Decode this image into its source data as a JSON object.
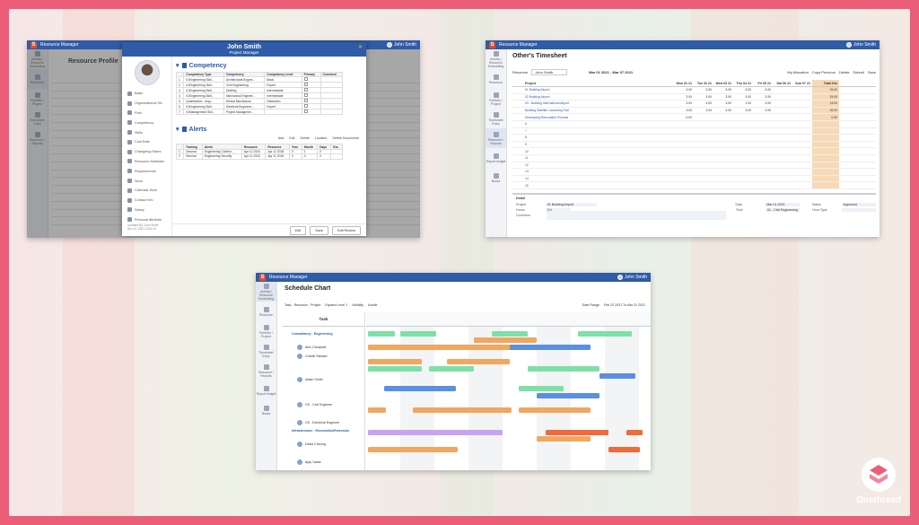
{
  "app": {
    "name": "Resource Manager",
    "logo_letter": "S"
  },
  "shot1": {
    "page_title": "Resource Profile",
    "modal": {
      "name": "John Smith",
      "role": "Project Manager",
      "close": "✕",
      "nav": [
        "Basic",
        "Organizational Str...",
        "Role",
        "Competency",
        "Skills",
        "Cost Rate",
        "Changelog Rates",
        "Resource Attributes",
        "Requirements",
        "Work",
        "Calendar Work",
        "Contact Info",
        "Salary",
        "Personal Attribute"
      ],
      "footer_note": "Updated By: John Smith",
      "footer_date": "Nov 10, 2021 10:51:12",
      "competency": {
        "title": "Competency",
        "headers": [
          "",
          "Competency Type",
          "Competency",
          "Competency Level",
          "Primary",
          "Comment"
        ],
        "rows": [
          [
            "1",
            "01Engineering Skill...",
            "Architectural Engine...",
            "Basic"
          ],
          [
            "2",
            "01Engineering Skill...",
            "Civil Engineering",
            "Expert"
          ],
          [
            "3",
            "01Engineering Skill...",
            "Drafting",
            "Intermediate"
          ],
          [
            "4",
            "01Engineering Skill...",
            "Mechanical Enginee...",
            "Intermediate"
          ],
          [
            "5",
            "Qualification - engi...",
            "Ethical Mechanical",
            "Distinction"
          ],
          [
            "6",
            "01Engineering Skill...",
            "Electrical Engineeri...",
            "Expert"
          ],
          [
            "7",
            "01Management Skil...",
            "Project Manageme...",
            ""
          ]
        ]
      },
      "alerts": {
        "title": "Alerts",
        "toolbar": [
          "Add",
          "Edit",
          "Delete",
          "Location",
          "Delete Documents"
        ],
        "headers": [
          "",
          "Training",
          "Alerts",
          "Resource",
          "Resource",
          "Year",
          "Month",
          "Days",
          "Exc"
        ],
        "rows": [
          [
            "1",
            "General",
            "Engineering Confirm...",
            "Apr 11 2018",
            "Apr 11 2018",
            "0",
            "1",
            "0"
          ],
          [
            "2",
            "General",
            "Engineering Security",
            "Apr 11 2018",
            "Apr 11 2018",
            "0",
            "0",
            "0"
          ]
        ]
      },
      "buttons": {
        "edit": "Edit",
        "save": "Save",
        "undo": "Edit Review"
      }
    }
  },
  "shot2": {
    "page_title": "Other's Timesheet",
    "resource_label": "Resource",
    "resource_value": "John Smith",
    "period": "Mar 01 2021 - Mar 07 2021",
    "actions": [
      "My Allocation",
      "Copy Previous",
      "Delete",
      "Submit",
      "Save"
    ],
    "headers": [
      "Project",
      "Mon 01 21",
      "Tue 02 21",
      "Wed 03 21",
      "Thu 04 21",
      "Fri 05 21",
      "Sat 06 21",
      "Sun 07 21",
      "Total Hrs"
    ],
    "rows": [
      [
        "01 Building Airport",
        "3.00",
        "3.00",
        "3.00",
        "3.00",
        "3.00",
        "",
        "",
        "15.00"
      ],
      [
        "02 Building Airport",
        "3.00",
        "3.00",
        "3.00",
        "3.00",
        "3.00",
        "",
        "",
        "15.00"
      ],
      [
        "03 - Building International Airport",
        "3.00",
        "3.00",
        "3.00",
        "1.00",
        "3.00",
        "",
        "",
        "13.00"
      ],
      [
        "Building Satellite Launching Pad",
        "3.00",
        "3.00",
        "3.00",
        "3.00",
        "3.00",
        "",
        "",
        "15.00"
      ],
      [
        "Developing Renovation Process",
        "0.00",
        "",
        "",
        "",
        "",
        "",
        "",
        "0.00"
      ],
      [
        "6",
        "",
        "",
        "",
        "",
        "",
        "",
        "",
        ""
      ],
      [
        "7",
        "",
        "",
        "",
        "",
        "",
        "",
        "",
        ""
      ],
      [
        "8",
        "",
        "",
        "",
        "",
        "",
        "",
        "",
        ""
      ],
      [
        "9",
        "",
        "",
        "",
        "",
        "",
        "",
        "",
        ""
      ],
      [
        "10",
        "",
        "",
        "",
        "",
        "",
        "",
        "",
        ""
      ],
      [
        "11",
        "",
        "",
        "",
        "",
        "",
        "",
        "",
        ""
      ],
      [
        "12",
        "",
        "",
        "",
        "",
        "",
        "",
        "",
        ""
      ],
      [
        "13",
        "",
        "",
        "",
        "",
        "",
        "",
        "",
        ""
      ],
      [
        "14",
        "",
        "",
        "",
        "",
        "",
        "",
        "",
        ""
      ],
      [
        "15",
        "",
        "",
        "",
        "",
        "",
        "",
        "",
        ""
      ]
    ],
    "detail": {
      "title": "Detail",
      "project_label": "Project",
      "project_value": "01 Building Airport",
      "hours_label": "Hours",
      "hours_value": "3.0",
      "comment_label": "Comment",
      "date_label": "Date",
      "date_value": "Mar 01 2021",
      "role_label": "Role",
      "role_value": "01 - Civil Engineering",
      "status_label": "Status",
      "status_value": "Approved",
      "hour_type_label": "Hour Type"
    }
  },
  "shot3": {
    "page_title": "Schedule Chart",
    "toolbar": [
      "Task - Resource - Project",
      "Expand Level 1",
      "Visibility",
      "Autofit"
    ],
    "range_label": "Date Range",
    "range_value": "Feb 22 2021 To Mar 31 2021",
    "left_header": "Task",
    "rows": [
      {
        "label": "Consultancy - Engineering",
        "group": true
      },
      {
        "label": "Alex Campbell",
        "group": false
      },
      {
        "label": "Charlie Stewart",
        "group": false
      },
      {
        "label": "Adam Smith",
        "group": false
      },
      {
        "label": "CE - Civil Engineer",
        "group": false
      },
      {
        "label": "CE - Electrical Engineer",
        "group": false
      },
      {
        "label": "Infrastructure - Renovation/Extension",
        "group": true
      },
      {
        "label": "David Cheung",
        "group": false
      },
      {
        "label": "Ajay Yadav",
        "group": false
      }
    ]
  },
  "sidebar": [
    "Activity / Resource Scheduling",
    "Resource",
    "Portfolio / Project",
    "Timesheet Entry",
    "Resource / Reports",
    "Report Insight",
    "Board"
  ],
  "user": "John Smith",
  "brand": {
    "name": "Onethread"
  },
  "colors": {
    "topbar": "#2f5ba7",
    "frame": "#ec5d78",
    "green": "#7ee0a6",
    "orange": "#f0a760",
    "blue": "#5b8fe0",
    "purple": "#c9a3f0",
    "red": "#f06a3a"
  }
}
